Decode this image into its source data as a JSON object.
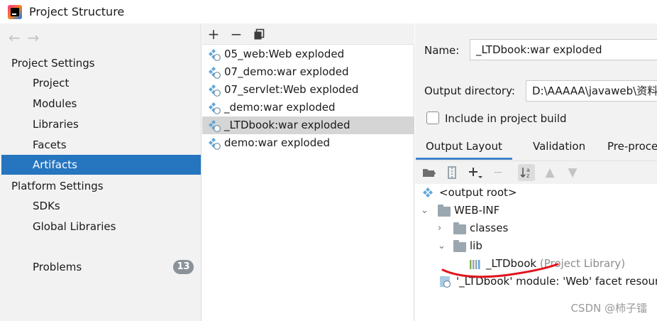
{
  "window": {
    "title": "Project Structure"
  },
  "nav": {
    "back_icon": "arrow-left-icon",
    "forward_icon": "arrow-right-icon"
  },
  "sidebar": {
    "project_settings_header": "Project Settings",
    "project_items": [
      {
        "label": "Project"
      },
      {
        "label": "Modules"
      },
      {
        "label": "Libraries"
      },
      {
        "label": "Facets"
      },
      {
        "label": "Artifacts",
        "selected": true
      }
    ],
    "platform_settings_header": "Platform Settings",
    "platform_items": [
      {
        "label": "SDKs"
      },
      {
        "label": "Global Libraries"
      }
    ],
    "problems": {
      "label": "Problems",
      "count": "13"
    }
  },
  "artifacts_toolbar": {
    "add": "+",
    "remove": "−",
    "copy_icon": "copy-icon"
  },
  "artifacts": [
    {
      "name": "05_web:Web exploded"
    },
    {
      "name": "07_demo:war exploded"
    },
    {
      "name": "07_servlet:Web exploded"
    },
    {
      "name": "_demo:war exploded"
    },
    {
      "name": "_LTDbook:war exploded",
      "selected": true
    },
    {
      "name": "demo:war exploded"
    }
  ],
  "details": {
    "name_label": "Name:",
    "name_value": "_LTDbook:war exploded",
    "output_dir_label": "Output directory:",
    "output_dir_value": "D:\\AAAAA\\javaweb\\资料",
    "include_build_label": "Include in project build",
    "include_build_checked": false,
    "tabs": [
      {
        "label": "Output Layout",
        "active": true
      },
      {
        "label": "Validation"
      },
      {
        "label": "Pre-proce"
      }
    ]
  },
  "tree": {
    "output_root": "<output root>",
    "web_inf": "WEB-INF",
    "classes": "classes",
    "lib": "lib",
    "library_name": "_LTDbook",
    "library_suffix": "(Project Library)",
    "module_resource": "'_LTDbook' module: 'Web' facet resources"
  },
  "watermark": "CSDN @柿子镭",
  "colors": {
    "selection_blue": "#2675bf",
    "annotation_red": "#e0141e",
    "tab_underline": "#4083c9"
  }
}
